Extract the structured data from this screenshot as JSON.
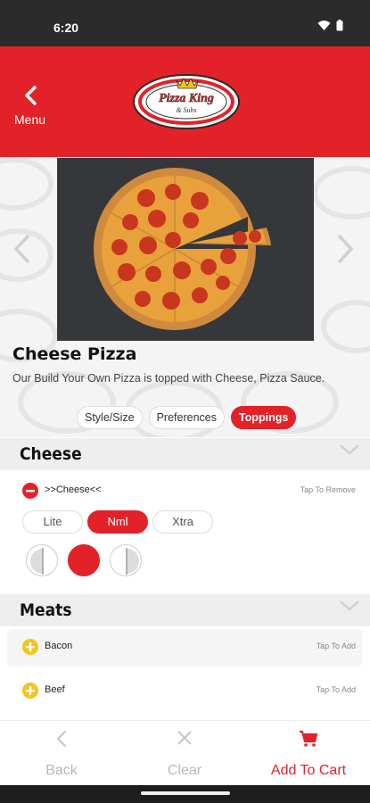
{
  "status_bar": {
    "time": "6:20"
  },
  "header": {
    "back_label": "Menu",
    "logo_text_main": "Pizza King",
    "logo_text_sub": "& Subs"
  },
  "product": {
    "title": "Cheese Pizza",
    "description": "Our Build Your Own Pizza is topped with Cheese, Pizza Sauce."
  },
  "tabs": [
    {
      "label": "Style/Size",
      "active": false
    },
    {
      "label": "Preferences",
      "active": false
    },
    {
      "label": "Toppings",
      "active": true
    }
  ],
  "sections": {
    "cheese": {
      "title": "Cheese",
      "item": {
        "name": ">>Cheese<<",
        "hint": "Tap To Remove"
      },
      "amount_options": [
        {
          "label": "Lite",
          "active": false
        },
        {
          "label": "Nml",
          "active": true
        },
        {
          "label": "Xtra",
          "active": false
        }
      ],
      "coverage_options": [
        "left-half",
        "whole",
        "right-half"
      ],
      "selected_coverage": "whole"
    },
    "meats": {
      "title": "Meats",
      "items": [
        {
          "name": "Bacon",
          "hint": "Tap To Add"
        },
        {
          "name": "Beef",
          "hint": "Tap To Add"
        }
      ]
    }
  },
  "bottom_bar": {
    "back_label": "Back",
    "clear_label": "Clear",
    "add_to_cart_label": "Add To Cart"
  },
  "colors": {
    "brand_red": "#e32128",
    "add_yellow": "#f5c518",
    "disabled_gray": "#b8b8b8"
  }
}
